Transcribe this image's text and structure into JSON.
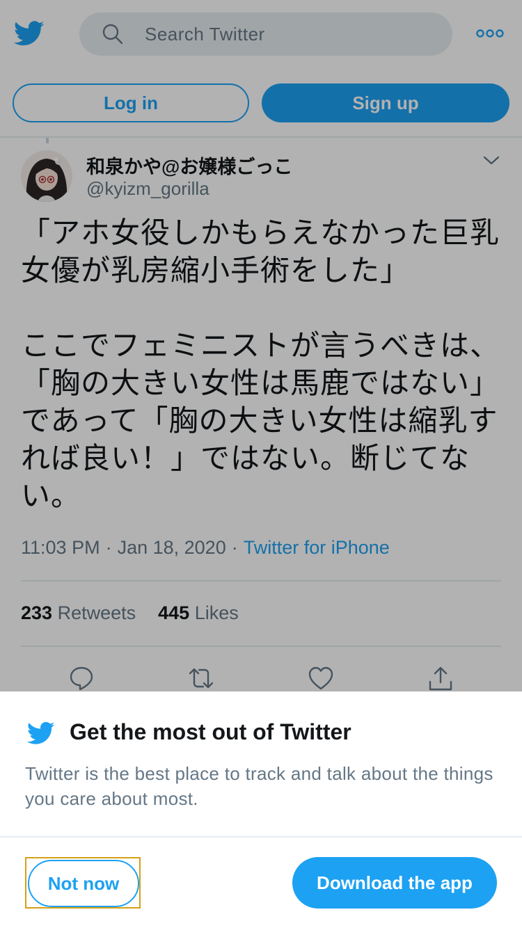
{
  "header": {
    "logo_icon": "twitter-bird-icon",
    "search_icon": "search-icon",
    "search_placeholder": "Search Twitter",
    "more_icon": "more-dots-icon",
    "login_label": "Log in",
    "signup_label": "Sign up"
  },
  "tweet": {
    "display_name": "和泉かや@お嬢様ごっこ",
    "handle": "@kyizm_gorilla",
    "caret_icon": "chevron-down-icon",
    "text": "「アホ女役しかもらえなかった巨乳女優が乳房縮小手術をした」\n\nここでフェミニストが言うべきは、「胸の大きい女性は馬鹿ではない」であって「胸の大きい女性は縮乳すれば良い！」ではない。断じてない。",
    "time": "11:03 PM",
    "date": "Jan 18, 2020",
    "separator": "·",
    "source": "Twitter for iPhone",
    "retweets_count": "233",
    "retweets_label": "Retweets",
    "likes_count": "445",
    "likes_label": "Likes",
    "actions": [
      "reply-icon",
      "retweet-icon",
      "like-icon",
      "share-icon"
    ]
  },
  "sheet": {
    "logo_icon": "twitter-bird-icon",
    "title": "Get the most out of Twitter",
    "description": "Twitter is the best place to track and talk about the things you care about most.",
    "not_now_label": "Not now",
    "download_label": "Download the app"
  },
  "colors": {
    "brand": "#1da1f2",
    "text_primary": "#14171a",
    "text_secondary": "#657786",
    "divider": "#e6ecf0",
    "focus_outline": "#d4a017"
  }
}
